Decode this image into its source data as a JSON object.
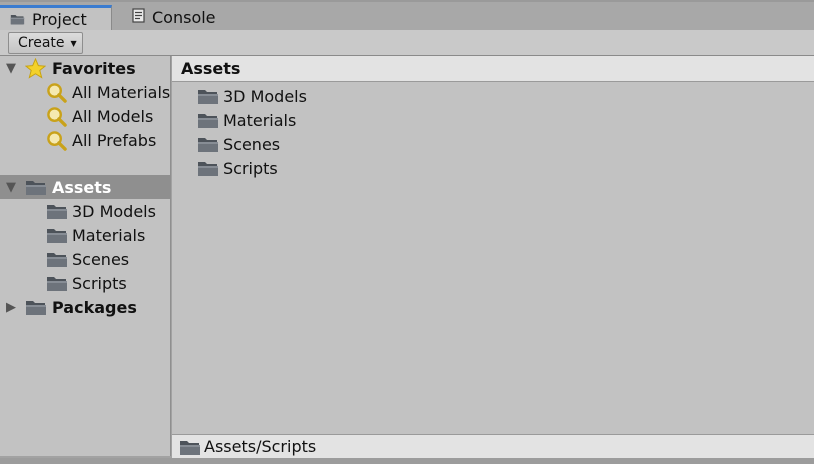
{
  "tabs": [
    {
      "label": "Project",
      "icon": "folder-icon",
      "active": true
    },
    {
      "label": "Console",
      "icon": "console-icon",
      "active": false
    }
  ],
  "toolbar": {
    "create_label": "Create"
  },
  "sidebar": {
    "favorites": {
      "label": "Favorites",
      "items": [
        "All Materials",
        "All Models",
        "All Prefabs"
      ]
    },
    "assets": {
      "label": "Assets",
      "children": [
        "3D Models",
        "Materials",
        "Scenes",
        "Scripts"
      ]
    },
    "packages": {
      "label": "Packages"
    }
  },
  "main": {
    "header": "Assets",
    "items": [
      "3D Models",
      "Materials",
      "Scenes",
      "Scripts"
    ]
  },
  "footer": {
    "path": "Assets/Scripts"
  },
  "colors": {
    "tab_accent": "#3b7cd0",
    "selected_row": "#8f8f8f",
    "panel_bg": "#c2c2c2",
    "header_bg": "#e3e3e3",
    "folder": "#5b6169"
  }
}
